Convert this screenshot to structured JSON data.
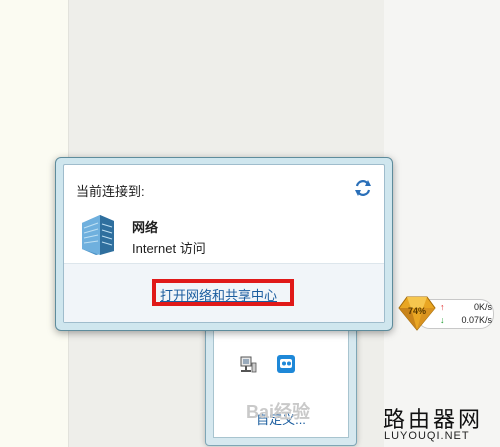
{
  "flyout": {
    "title": "当前连接到:",
    "network_name": "网络",
    "network_status": "Internet 访问",
    "open_center_link": "打开网络和共享中心",
    "refresh_icon": "refresh-icon",
    "network_icon": "network-building-icon"
  },
  "tray_overflow": {
    "customize_link": "自定义...",
    "icons": [
      "network-tray-icon",
      "app-tray-icon"
    ]
  },
  "speed_widget": {
    "percent": "74%",
    "upload": "0K/s",
    "download": "0.07K/s"
  },
  "watermark": {
    "baidu": "Bai经验",
    "site": "路由器网",
    "domain": "LUYOUQI.NET"
  },
  "colors": {
    "highlight_box": "#e01919",
    "link": "#1a5c9e",
    "flyout_frame": "#cfe6ee"
  }
}
